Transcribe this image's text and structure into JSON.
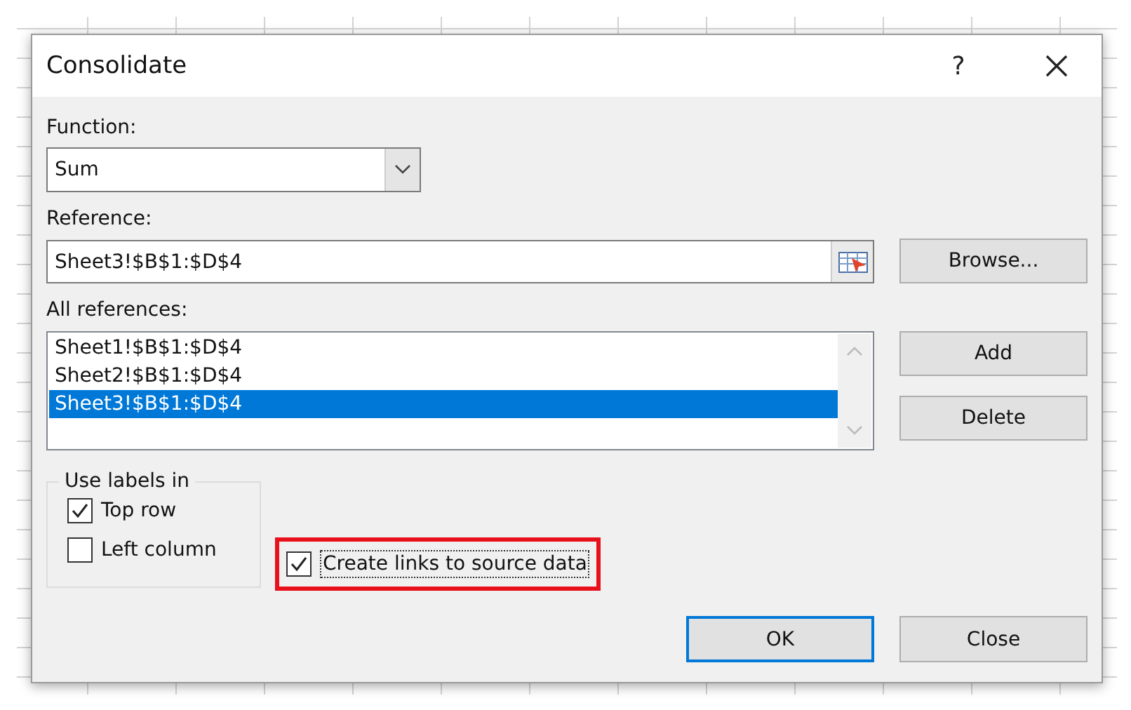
{
  "window": {
    "title": "Consolidate",
    "help": "?"
  },
  "function": {
    "label": "Function:",
    "value": "Sum"
  },
  "reference": {
    "label": "Reference:",
    "value": "Sheet3!$B$1:$D$4"
  },
  "browse_button": "Browse...",
  "all_references": {
    "label": "All references:",
    "items": [
      {
        "text": "Sheet1!$B$1:$D$4",
        "selected": false
      },
      {
        "text": "Sheet2!$B$1:$D$4",
        "selected": false
      },
      {
        "text": "Sheet3!$B$1:$D$4",
        "selected": true
      }
    ]
  },
  "side_buttons": [
    "Add",
    "Delete"
  ],
  "use_labels": {
    "title": "Use labels in",
    "options": [
      {
        "label": "Top row",
        "checked": true
      },
      {
        "label": "Left column",
        "checked": false
      }
    ]
  },
  "create_links": {
    "label": "Create links to source data",
    "checked": true,
    "highlighted": true
  },
  "footer_buttons": [
    {
      "label": "OK",
      "default": true
    },
    {
      "label": "Close",
      "default": false
    }
  ]
}
